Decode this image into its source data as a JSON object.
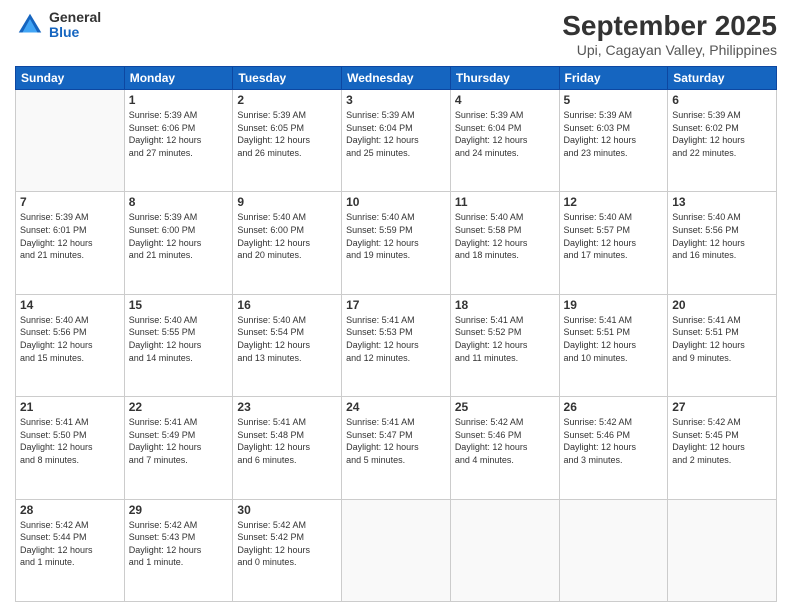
{
  "logo": {
    "general": "General",
    "blue": "Blue"
  },
  "header": {
    "title": "September 2025",
    "subtitle": "Upi, Cagayan Valley, Philippines"
  },
  "days": [
    "Sunday",
    "Monday",
    "Tuesday",
    "Wednesday",
    "Thursday",
    "Friday",
    "Saturday"
  ],
  "weeks": [
    [
      {
        "date": "",
        "info": ""
      },
      {
        "date": "1",
        "info": "Sunrise: 5:39 AM\nSunset: 6:06 PM\nDaylight: 12 hours\nand 27 minutes."
      },
      {
        "date": "2",
        "info": "Sunrise: 5:39 AM\nSunset: 6:05 PM\nDaylight: 12 hours\nand 26 minutes."
      },
      {
        "date": "3",
        "info": "Sunrise: 5:39 AM\nSunset: 6:04 PM\nDaylight: 12 hours\nand 25 minutes."
      },
      {
        "date": "4",
        "info": "Sunrise: 5:39 AM\nSunset: 6:04 PM\nDaylight: 12 hours\nand 24 minutes."
      },
      {
        "date": "5",
        "info": "Sunrise: 5:39 AM\nSunset: 6:03 PM\nDaylight: 12 hours\nand 23 minutes."
      },
      {
        "date": "6",
        "info": "Sunrise: 5:39 AM\nSunset: 6:02 PM\nDaylight: 12 hours\nand 22 minutes."
      }
    ],
    [
      {
        "date": "7",
        "info": "Sunrise: 5:39 AM\nSunset: 6:01 PM\nDaylight: 12 hours\nand 21 minutes."
      },
      {
        "date": "8",
        "info": "Sunrise: 5:39 AM\nSunset: 6:00 PM\nDaylight: 12 hours\nand 21 minutes."
      },
      {
        "date": "9",
        "info": "Sunrise: 5:40 AM\nSunset: 6:00 PM\nDaylight: 12 hours\nand 20 minutes."
      },
      {
        "date": "10",
        "info": "Sunrise: 5:40 AM\nSunset: 5:59 PM\nDaylight: 12 hours\nand 19 minutes."
      },
      {
        "date": "11",
        "info": "Sunrise: 5:40 AM\nSunset: 5:58 PM\nDaylight: 12 hours\nand 18 minutes."
      },
      {
        "date": "12",
        "info": "Sunrise: 5:40 AM\nSunset: 5:57 PM\nDaylight: 12 hours\nand 17 minutes."
      },
      {
        "date": "13",
        "info": "Sunrise: 5:40 AM\nSunset: 5:56 PM\nDaylight: 12 hours\nand 16 minutes."
      }
    ],
    [
      {
        "date": "14",
        "info": "Sunrise: 5:40 AM\nSunset: 5:56 PM\nDaylight: 12 hours\nand 15 minutes."
      },
      {
        "date": "15",
        "info": "Sunrise: 5:40 AM\nSunset: 5:55 PM\nDaylight: 12 hours\nand 14 minutes."
      },
      {
        "date": "16",
        "info": "Sunrise: 5:40 AM\nSunset: 5:54 PM\nDaylight: 12 hours\nand 13 minutes."
      },
      {
        "date": "17",
        "info": "Sunrise: 5:41 AM\nSunset: 5:53 PM\nDaylight: 12 hours\nand 12 minutes."
      },
      {
        "date": "18",
        "info": "Sunrise: 5:41 AM\nSunset: 5:52 PM\nDaylight: 12 hours\nand 11 minutes."
      },
      {
        "date": "19",
        "info": "Sunrise: 5:41 AM\nSunset: 5:51 PM\nDaylight: 12 hours\nand 10 minutes."
      },
      {
        "date": "20",
        "info": "Sunrise: 5:41 AM\nSunset: 5:51 PM\nDaylight: 12 hours\nand 9 minutes."
      }
    ],
    [
      {
        "date": "21",
        "info": "Sunrise: 5:41 AM\nSunset: 5:50 PM\nDaylight: 12 hours\nand 8 minutes."
      },
      {
        "date": "22",
        "info": "Sunrise: 5:41 AM\nSunset: 5:49 PM\nDaylight: 12 hours\nand 7 minutes."
      },
      {
        "date": "23",
        "info": "Sunrise: 5:41 AM\nSunset: 5:48 PM\nDaylight: 12 hours\nand 6 minutes."
      },
      {
        "date": "24",
        "info": "Sunrise: 5:41 AM\nSunset: 5:47 PM\nDaylight: 12 hours\nand 5 minutes."
      },
      {
        "date": "25",
        "info": "Sunrise: 5:42 AM\nSunset: 5:46 PM\nDaylight: 12 hours\nand 4 minutes."
      },
      {
        "date": "26",
        "info": "Sunrise: 5:42 AM\nSunset: 5:46 PM\nDaylight: 12 hours\nand 3 minutes."
      },
      {
        "date": "27",
        "info": "Sunrise: 5:42 AM\nSunset: 5:45 PM\nDaylight: 12 hours\nand 2 minutes."
      }
    ],
    [
      {
        "date": "28",
        "info": "Sunrise: 5:42 AM\nSunset: 5:44 PM\nDaylight: 12 hours\nand 1 minute."
      },
      {
        "date": "29",
        "info": "Sunrise: 5:42 AM\nSunset: 5:43 PM\nDaylight: 12 hours\nand 1 minute."
      },
      {
        "date": "30",
        "info": "Sunrise: 5:42 AM\nSunset: 5:42 PM\nDaylight: 12 hours\nand 0 minutes."
      },
      {
        "date": "",
        "info": ""
      },
      {
        "date": "",
        "info": ""
      },
      {
        "date": "",
        "info": ""
      },
      {
        "date": "",
        "info": ""
      }
    ]
  ]
}
